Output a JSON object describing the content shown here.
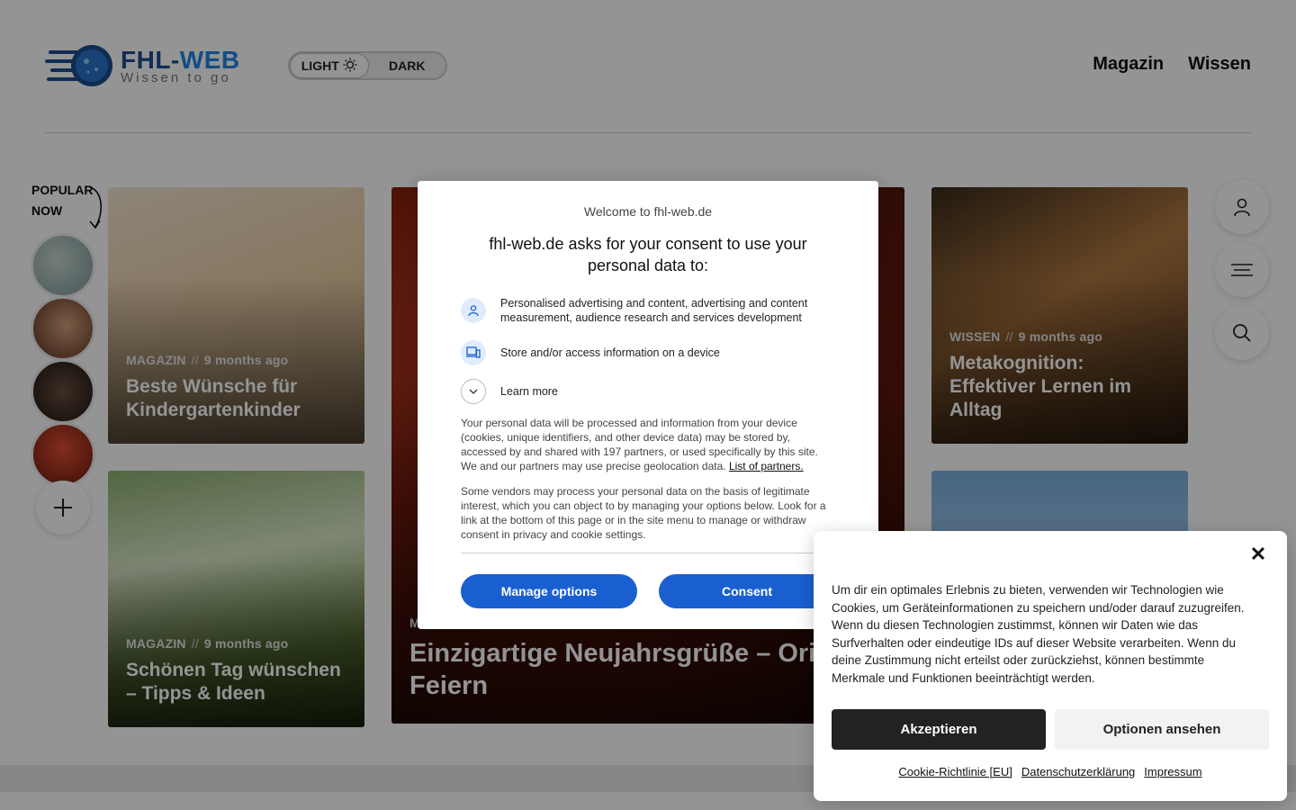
{
  "header": {
    "logo_title_a": "FHL-",
    "logo_title_b": "WEB",
    "logo_subtitle": "Wissen to go",
    "mode_light": "LIGHT",
    "mode_dark": "DARK",
    "nav": [
      "Magazin",
      "Wissen"
    ]
  },
  "popular": {
    "label_line1": "POPULAR",
    "label_line2": "NOW"
  },
  "cards": [
    {
      "category": "MAGAZIN",
      "separator": "//",
      "time": "9 months ago",
      "title": "Beste Wünsche für Kindergartenkinder"
    },
    {
      "category": "MAGAZIN",
      "separator": "//",
      "time": "9 months ago",
      "title": "Schönen Tag wünschen – Tipps & Ideen"
    },
    {
      "category": "M",
      "separator": "",
      "time": "",
      "title": "Einzigartige Neujahrsgrüße – Originell Feiern"
    },
    {
      "category": "WISSEN",
      "separator": "//",
      "time": "9 months ago",
      "title": "Metakognition: Effektiver Lernen im Alltag"
    }
  ],
  "consent": {
    "welcome": "Welcome to fhl-web.de",
    "heading": "fhl-web.de asks for your consent to use your personal data to:",
    "purpose1": "Personalised advertising and content, advertising and content measurement, audience research and services development",
    "purpose2": "Store and/or access information on a device",
    "learn_more": "Learn more",
    "para1": "Your personal data will be processed and information from your device (cookies, unique identifiers, and other device data) may be stored by, accessed by and shared with 197 partners, or used specifically by this site. We and our partners may use precise geolocation data.",
    "partners_link": "List of partners.",
    "para2": "Some vendors may process your personal data on the basis of legitimate interest, which you can object to by managing your options below. Look for a link at the bottom of this page or in the site menu to manage or withdraw consent in privacy and cookie settings.",
    "manage_btn": "Manage options",
    "consent_btn": "Consent"
  },
  "cookie": {
    "close": "✕",
    "text": "Um dir ein optimales Erlebnis zu bieten, verwenden wir Technologien wie Cookies, um Geräteinformationen zu speichern und/oder darauf zuzugreifen. Wenn du diesen Technologien zustimmst, können wir Daten wie das Surfverhalten oder eindeutige IDs auf dieser Website verarbeiten. Wenn du deine Zustimmung nicht erteilst oder zurückziehst, können bestimmte Merkmale und Funktionen beeinträchtigt werden.",
    "accept": "Akzeptieren",
    "options": "Optionen ansehen",
    "links": [
      "Cookie-Richtlinie [EU]",
      "Datenschutzerklärung",
      "Impressum"
    ]
  },
  "colors": {
    "brand_dark": "#1a4f8f",
    "brand_light": "#1e86e8",
    "consent_button": "#1a5fd0",
    "cookie_accept": "#222222"
  }
}
